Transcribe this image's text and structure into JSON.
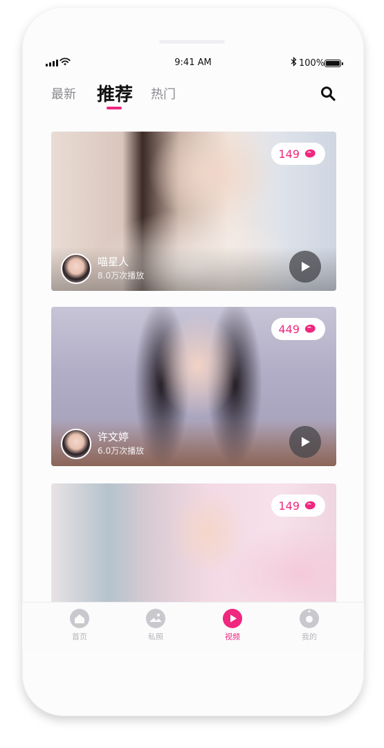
{
  "status_bar": {
    "time": "9:41 AM",
    "battery": "100%"
  },
  "header": {
    "tabs": [
      {
        "label": "最新",
        "active": false
      },
      {
        "label": "推荐",
        "active": true
      },
      {
        "label": "热门",
        "active": false
      }
    ],
    "search_icon": "search-icon"
  },
  "feed": {
    "videos": [
      {
        "counter": "149",
        "user_name": "喵星人",
        "plays": "8.0万次播放"
      },
      {
        "counter": "449",
        "user_name": "许文婷",
        "plays": "6.0万次播放"
      },
      {
        "counter": "149"
      }
    ]
  },
  "tab_bar": {
    "items": [
      {
        "label": "首页",
        "icon": "home-icon",
        "active": false
      },
      {
        "label": "私照",
        "icon": "photo-icon",
        "active": false
      },
      {
        "label": "视频",
        "icon": "video-play-icon",
        "active": true
      },
      {
        "label": "我的",
        "icon": "profile-icon",
        "active": false
      }
    ]
  },
  "colors": {
    "accent": "#f0277e",
    "inactive_text": "#8a8a8f",
    "tab_bar_inactive": "#b5b5ba"
  }
}
